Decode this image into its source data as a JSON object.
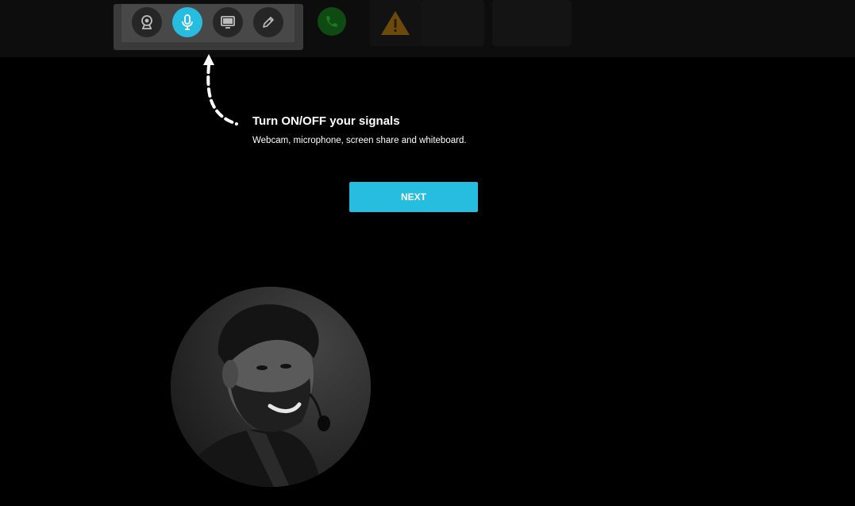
{
  "toolbar": {
    "buttons": [
      {
        "name": "webcam",
        "icon": "webcam-icon",
        "active": false
      },
      {
        "name": "microphone",
        "icon": "microphone-icon",
        "active": true
      },
      {
        "name": "screen-share",
        "icon": "monitor-icon",
        "active": false
      },
      {
        "name": "whiteboard",
        "icon": "pencil-icon",
        "active": false
      }
    ],
    "call_icon": "phone-icon",
    "warning_icon": "warning-icon"
  },
  "tooltip": {
    "title": "Turn ON/OFF your signals",
    "description": "Webcam, microphone, screen share and whiteboard.",
    "next_label": "NEXT"
  },
  "colors": {
    "accent": "#27bde0",
    "call_green": "#0f4a12",
    "warning_amber": "#6b4a0c"
  },
  "avatar": {
    "icon": "user-avatar"
  }
}
